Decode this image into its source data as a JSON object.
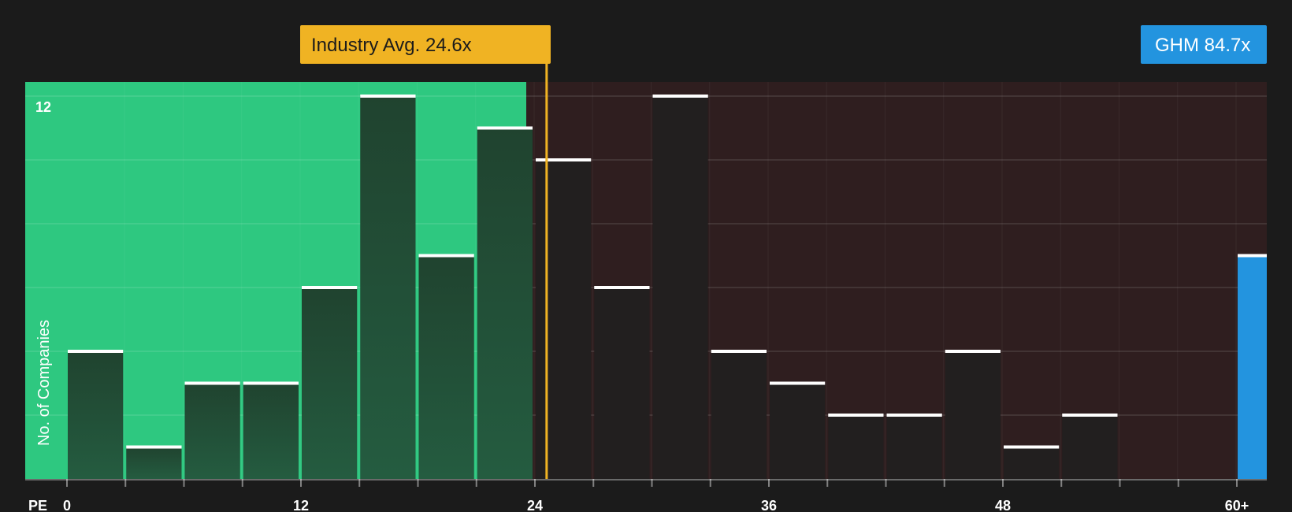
{
  "chart_data": {
    "type": "bar",
    "xlabel": "PE",
    "ylabel": "No. of Companies",
    "x_tick_labels": [
      "0",
      "12",
      "24",
      "36",
      "48",
      "60+"
    ],
    "y_tick_labels": [
      "12"
    ],
    "ylim": [
      0,
      12
    ],
    "bins": [
      {
        "from": 0,
        "to": 3,
        "count": 4
      },
      {
        "from": 3,
        "to": 6,
        "count": 1
      },
      {
        "from": 6,
        "to": 9,
        "count": 3
      },
      {
        "from": 9,
        "to": 12,
        "count": 3
      },
      {
        "from": 12,
        "to": 15,
        "count": 6
      },
      {
        "from": 15,
        "to": 18,
        "count": 12
      },
      {
        "from": 18,
        "to": 21,
        "count": 7
      },
      {
        "from": 21,
        "to": 24,
        "count": 11
      },
      {
        "from": 24,
        "to": 27,
        "count": 10
      },
      {
        "from": 27,
        "to": 30,
        "count": 6
      },
      {
        "from": 30,
        "to": 33,
        "count": 12
      },
      {
        "from": 33,
        "to": 36,
        "count": 4
      },
      {
        "from": 36,
        "to": 39,
        "count": 3
      },
      {
        "from": 39,
        "to": 42,
        "count": 2
      },
      {
        "from": 42,
        "to": 45,
        "count": 2
      },
      {
        "from": 45,
        "to": 48,
        "count": 4
      },
      {
        "from": 48,
        "to": 51,
        "count": 1
      },
      {
        "from": 51,
        "to": 54,
        "count": 2
      }
    ],
    "highlight": {
      "label": "GHM 84.7x",
      "value": 84.7,
      "count": 7,
      "color": "#2394df"
    },
    "industry_average": {
      "label": "Industry Avg. 24.6x",
      "value": 24.6,
      "color": "#f0b323"
    },
    "colors": {
      "below_region": "#2ec880",
      "above_region": "#2f1e1f",
      "bar_below": "#21523a",
      "bar_above": "#221f1f",
      "bar_top": "#ffffff",
      "background": "#1b1b1b"
    }
  }
}
